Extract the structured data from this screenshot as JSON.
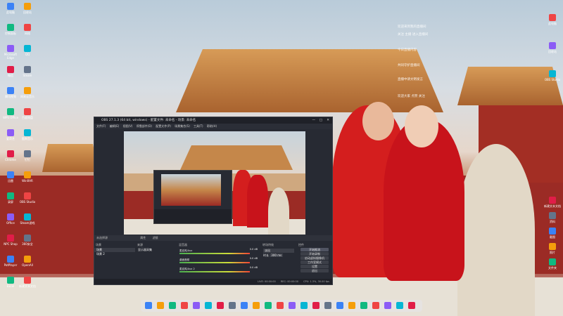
{
  "window": {
    "title": "OBS 27.1.3 (64 bit, windows) - 配置文件: 未命名 - 场景: 未命名",
    "menus": [
      "文件(F)",
      "编辑(E)",
      "视图(V)",
      "停靠部件(D)",
      "配置文件(P)",
      "场景集合(S)",
      "工具(T)",
      "帮助(H)"
    ],
    "controls": [
      "—",
      "□",
      "✕"
    ]
  },
  "docks": {
    "context_bar": "未选择源",
    "properties": "属性",
    "filters": "滤镜",
    "scenes": {
      "header": "场景",
      "items": [
        "场景",
        "场景 2"
      ]
    },
    "sources": {
      "header": "来源",
      "items": [
        "显示器采集"
      ]
    },
    "mixer": {
      "header": "混音器",
      "channels": [
        {
          "name": "麦克风/Aux",
          "level": "0.0 dB"
        },
        {
          "name": "桌面音频",
          "level": "0.0 dB"
        },
        {
          "name": "麦克风/Aux 2",
          "level": "0.0 dB"
        }
      ]
    },
    "transitions": {
      "header": "转场特效",
      "type": "淡出",
      "duration_label": "时长",
      "duration": "300 ms"
    },
    "controls": {
      "header": "控件",
      "buttons": [
        "开始推流",
        "开始录制",
        "启动虚拟摄像机",
        "工作室模式",
        "设置",
        "退出"
      ]
    }
  },
  "status": {
    "live": "LIVE: 00:00:00",
    "rec": "REC: 00:00:00",
    "cpu": "CPU: 1.3%, 30.00 fps"
  },
  "desktop": {
    "left_icons": [
      "此电脑",
      "回收站",
      "控制面板",
      "网络",
      "Microsoft Edge",
      "QQ",
      "微信",
      "Steam",
      "腾讯视频",
      "网易云音乐",
      "WPS Office",
      "百度网盘",
      "爱奇艺",
      "酷狗音乐",
      "Chrome",
      "钉钉",
      "迅雷",
      "WinRAR",
      "录屏",
      "OBS Studio",
      "Office",
      "Steam游戏",
      "NPC Shop",
      "360安全",
      "PotPlayer",
      "OpenAll",
      "Excel",
      "新建文本文档"
    ],
    "right_icons": [
      "此电脑",
      "回收站",
      "OBS Studio",
      "新建文本文档",
      "资料",
      "截图",
      "照片",
      "文件夹"
    ],
    "overlay_text": [
      "欢迎来到我的直播间",
      "关注 主播 进入直播间",
      "今日直播内容",
      "共同守护直播间",
      "直播中请文明发言",
      "欢迎大家 点赞 关注"
    ]
  },
  "taskbar": {
    "icons": [
      "finder-icon",
      "qq-icon",
      "wechat-icon",
      "chrome-icon",
      "edge-icon",
      "steam-icon",
      "obs-icon",
      "music-icon",
      "video-icon",
      "folder-icon",
      "mail-icon",
      "settings-icon",
      "game-icon",
      "store-icon",
      "terminal-icon",
      "photo-icon",
      "cloud-icon",
      "note-icon",
      "calc-icon",
      "map-icon",
      "phone-icon",
      "clock-icon",
      "trash-icon"
    ]
  }
}
